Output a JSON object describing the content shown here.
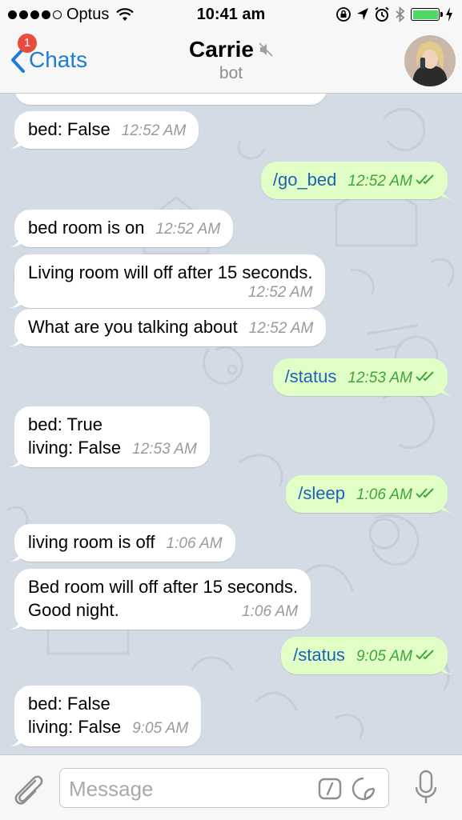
{
  "status_bar": {
    "carrier": "Optus",
    "time": "10:41 am"
  },
  "nav": {
    "back_label": "Chats",
    "badge_count": "1",
    "contact_name": "Carrie",
    "contact_subtitle": "bot",
    "muted_icon": "speaker-muted-icon"
  },
  "messages": [
    {
      "dir": "in",
      "lines": [
        "bed: False"
      ],
      "time": "12:52 AM"
    },
    {
      "dir": "out",
      "lines": [
        "/go_bed"
      ],
      "time": "12:52 AM"
    },
    {
      "dir": "in",
      "lines": [
        "bed room is on"
      ],
      "time": "12:52 AM"
    },
    {
      "dir": "in",
      "lines": [
        "Living room will off after 15 seconds."
      ],
      "time": "12:52 AM"
    },
    {
      "dir": "in",
      "lines": [
        "What are you talking about"
      ],
      "time": "12:52 AM"
    },
    {
      "dir": "out",
      "lines": [
        "/status"
      ],
      "time": "12:53 AM"
    },
    {
      "dir": "in",
      "lines": [
        "bed: True",
        "living: False"
      ],
      "time": "12:53 AM"
    },
    {
      "dir": "out",
      "lines": [
        "/sleep"
      ],
      "time": "1:06 AM"
    },
    {
      "dir": "in",
      "lines": [
        "living room is off"
      ],
      "time": "1:06 AM"
    },
    {
      "dir": "in",
      "lines": [
        "Bed room will off after 15 seconds.",
        "Good night."
      ],
      "time": "1:06 AM"
    },
    {
      "dir": "out",
      "lines": [
        "/status"
      ],
      "time": "9:05 AM"
    },
    {
      "dir": "in",
      "lines": [
        "bed: False",
        "living: False"
      ],
      "time": "9:05 AM"
    }
  ],
  "input": {
    "placeholder": "Message"
  },
  "colors": {
    "accent": "#1c7cd6",
    "outgoing_bubble": "#e1fec6",
    "incoming_bubble": "#ffffff",
    "outgoing_time": "#3fa53a",
    "badge": "#e94b3c",
    "battery": "#4cd964"
  }
}
